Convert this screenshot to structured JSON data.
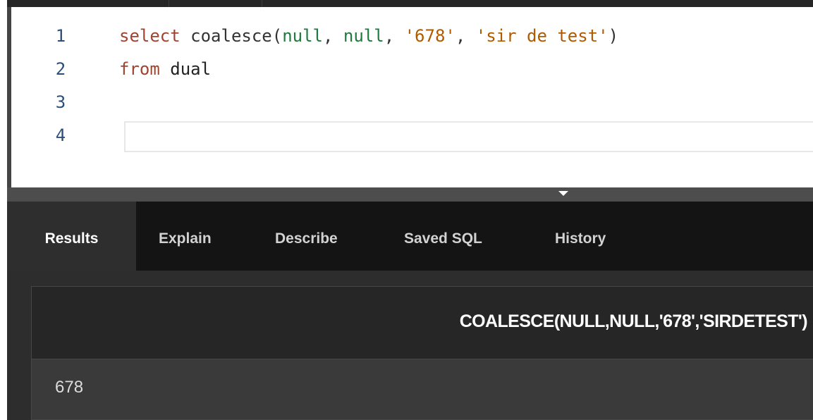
{
  "editor": {
    "lines": [
      {
        "number": "1",
        "tokens": {
          "kw": "select",
          "fn": "coalesce(",
          "n1": "null",
          "c1": ", ",
          "n2": "null",
          "c2": ", ",
          "s1": "'678'",
          "c3": ", ",
          "s2": "'sir de test'",
          "close": ")"
        }
      },
      {
        "number": "2",
        "tokens": {
          "kw": "from",
          "rest": " dual"
        }
      },
      {
        "number": "3"
      },
      {
        "number": "4"
      }
    ]
  },
  "tabs": [
    {
      "label": "Results",
      "active": true
    },
    {
      "label": "Explain",
      "active": false
    },
    {
      "label": "Describe",
      "active": false
    },
    {
      "label": "Saved SQL",
      "active": false
    },
    {
      "label": "History",
      "active": false
    }
  ],
  "results": {
    "columns": [
      "COALESCE(NULL,NULL,'678','SIRDETEST')"
    ],
    "rows": [
      [
        "678"
      ]
    ]
  },
  "colors": {
    "keyword": "#a0432f",
    "string": "#b05a00",
    "null": "#1e7a3d",
    "line_number": "#2b4f7a"
  }
}
